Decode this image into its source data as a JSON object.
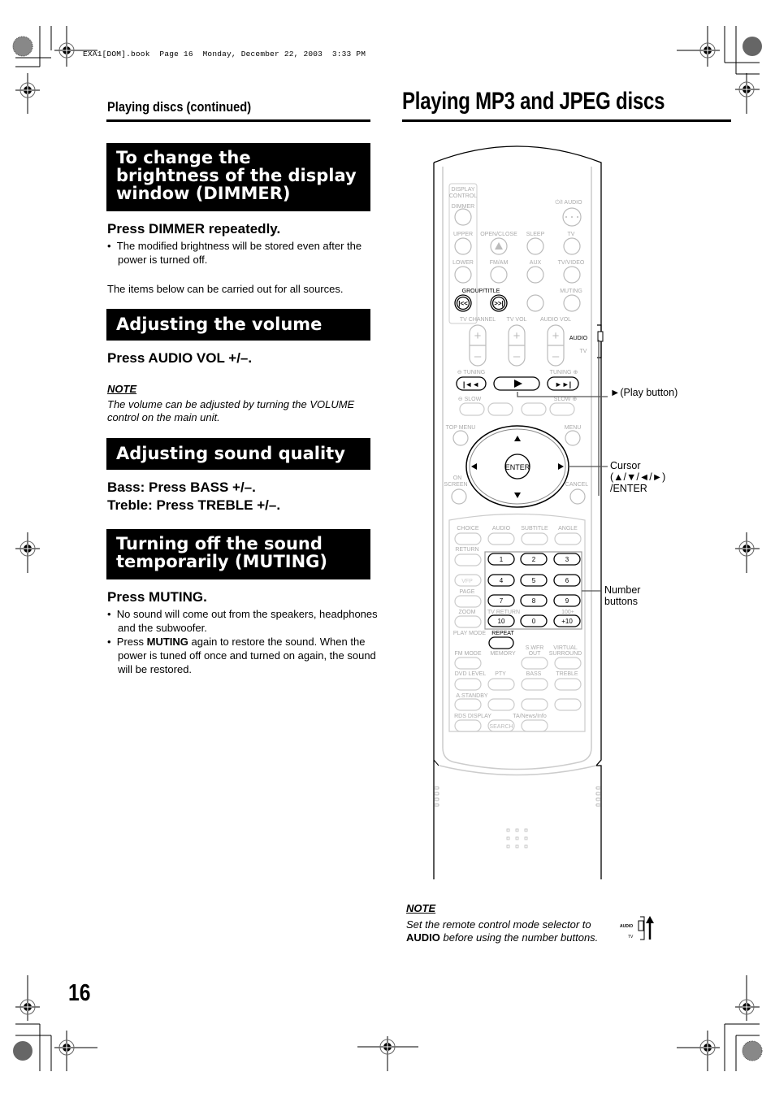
{
  "print_header": "EXA1[DOM].book  Page 16  Monday, December 22, 2003  3:33 PM",
  "left": {
    "section_title": "Playing discs (continued)",
    "dimmer": {
      "banner_lines": [
        "To change the",
        "brightness of the display",
        "window (DIMMER)"
      ],
      "instruction": "Press DIMMER repeatedly.",
      "bullets": [
        "The modified brightness will be stored even after the power is turned off."
      ],
      "note_all_sources": "The items below can be carried out for all sources."
    },
    "volume": {
      "banner": "Adjusting the volume",
      "instruction": "Press AUDIO VOL +/–.",
      "note_label": "NOTE",
      "note_text": "The volume can be adjusted by turning the VOLUME control on the main unit."
    },
    "sound_quality": {
      "banner": "Adjusting sound quality",
      "bass": "Bass:  Press BASS +/–.",
      "treble": "Treble: Press TREBLE +/–."
    },
    "muting": {
      "banner_lines": [
        "Turning off the sound",
        "temporarily (MUTING)"
      ],
      "instruction": "Press MUTING.",
      "bullet1": "No sound will come out from the speakers, headphones and the subwoofer.",
      "bullet2_pre": "Press ",
      "bullet2_bold": "MUTING",
      "bullet2_post": " again to restore the sound. When the power is tuned off once and turned on again, the sound will be restored."
    }
  },
  "right": {
    "title": "Playing MP3 and JPEG discs",
    "callouts": {
      "play": "►(Play button)",
      "cursor_1": "Cursor",
      "cursor_2": "(▲/▼/◄/►)",
      "cursor_3": "/ENTER",
      "number_1": "Number",
      "number_2": "buttons"
    },
    "note_label": "NOTE",
    "note_line1": "Set the remote control mode selector to",
    "note_bold": "AUDIO",
    "note_line2": " before using the number buttons.",
    "selector_audio": "AUDIO",
    "selector_tv": "TV"
  },
  "remote": {
    "display_control": [
      "DISPLAY",
      "CONTROL"
    ],
    "labels": {
      "dimmer": "DIMMER",
      "power_audio": "⏻/I AUDIO",
      "upper": "UPPER",
      "open_close": "OPEN/CLOSE",
      "sleep": "SLEEP",
      "tv": "TV",
      "lower": "LOWER",
      "fm_am": "FM/AM",
      "aux": "AUX",
      "tv_video": "TV/VIDEO",
      "group_title": "GROUP/TITLE",
      "muting": "MUTING",
      "tv_channel": "TV CHANNEL",
      "tv_vol": "TV VOL",
      "audio_vol": "AUDIO VOL",
      "audio_switch": "AUDIO",
      "tv_switch": "TV",
      "tuning_minus": "⊖ TUNING",
      "tuning_plus": "TUNING ⊕",
      "slow_minus": "⊖ SLOW",
      "slow_plus": "SLOW ⊕",
      "top_menu": "TOP MENU",
      "menu": "MENU",
      "on_screen_1": "ON",
      "on_screen_2": "SCREEN",
      "cancel": "CANCEL",
      "enter": "ENTER",
      "choice": "CHOICE",
      "audio": "AUDIO",
      "subtitle": "SUBTITLE",
      "angle": "ANGLE",
      "return": "RETURN",
      "vfp": "VFP",
      "page": "PAGE",
      "zoom": "ZOOM",
      "tv_return": "TV RETURN",
      "hundred_plus": "100+",
      "play_mode": "PLAY MODE",
      "repeat": "REPEAT",
      "fm_mode": "FM MODE",
      "memory": "MEMORY",
      "swfr_1": "S.WFR",
      "swfr_2": "OUT",
      "virtual_1": "VIRTUAL",
      "virtual_2": "SURROUND",
      "dvd_level": "DVD LEVEL",
      "pty": "PTY",
      "bass": "BASS",
      "treble": "TREBLE",
      "a_standby": "A.STANDBY",
      "rds_display": "RDS DISPLAY",
      "ta_news": "TA/News/Info",
      "search": "SEARCH"
    },
    "number_keys": [
      "1",
      "2",
      "3",
      "4",
      "5",
      "6",
      "7",
      "8",
      "9",
      "10",
      "0",
      "+10"
    ]
  },
  "page_number": "16"
}
